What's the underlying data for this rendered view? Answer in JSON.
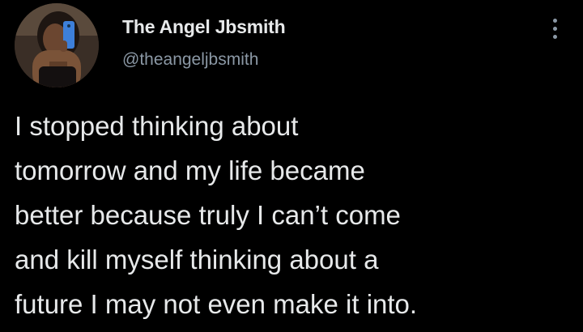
{
  "tweet": {
    "author": {
      "display_name": "The Angel Jbsmith",
      "handle": "@theangeljbsmith",
      "avatar_icon": "profile-photo"
    },
    "menu_icon": "more-vertical-icon",
    "text_lines": [
      "I stopped thinking about",
      "tomorrow and my life became",
      "better because truly I can’t come",
      "and kill myself thinking about a",
      "future I may not even make it into."
    ]
  },
  "colors": {
    "background": "#000000",
    "primary_text": "#e7e9ea",
    "secondary_text": "#8b98a5"
  }
}
